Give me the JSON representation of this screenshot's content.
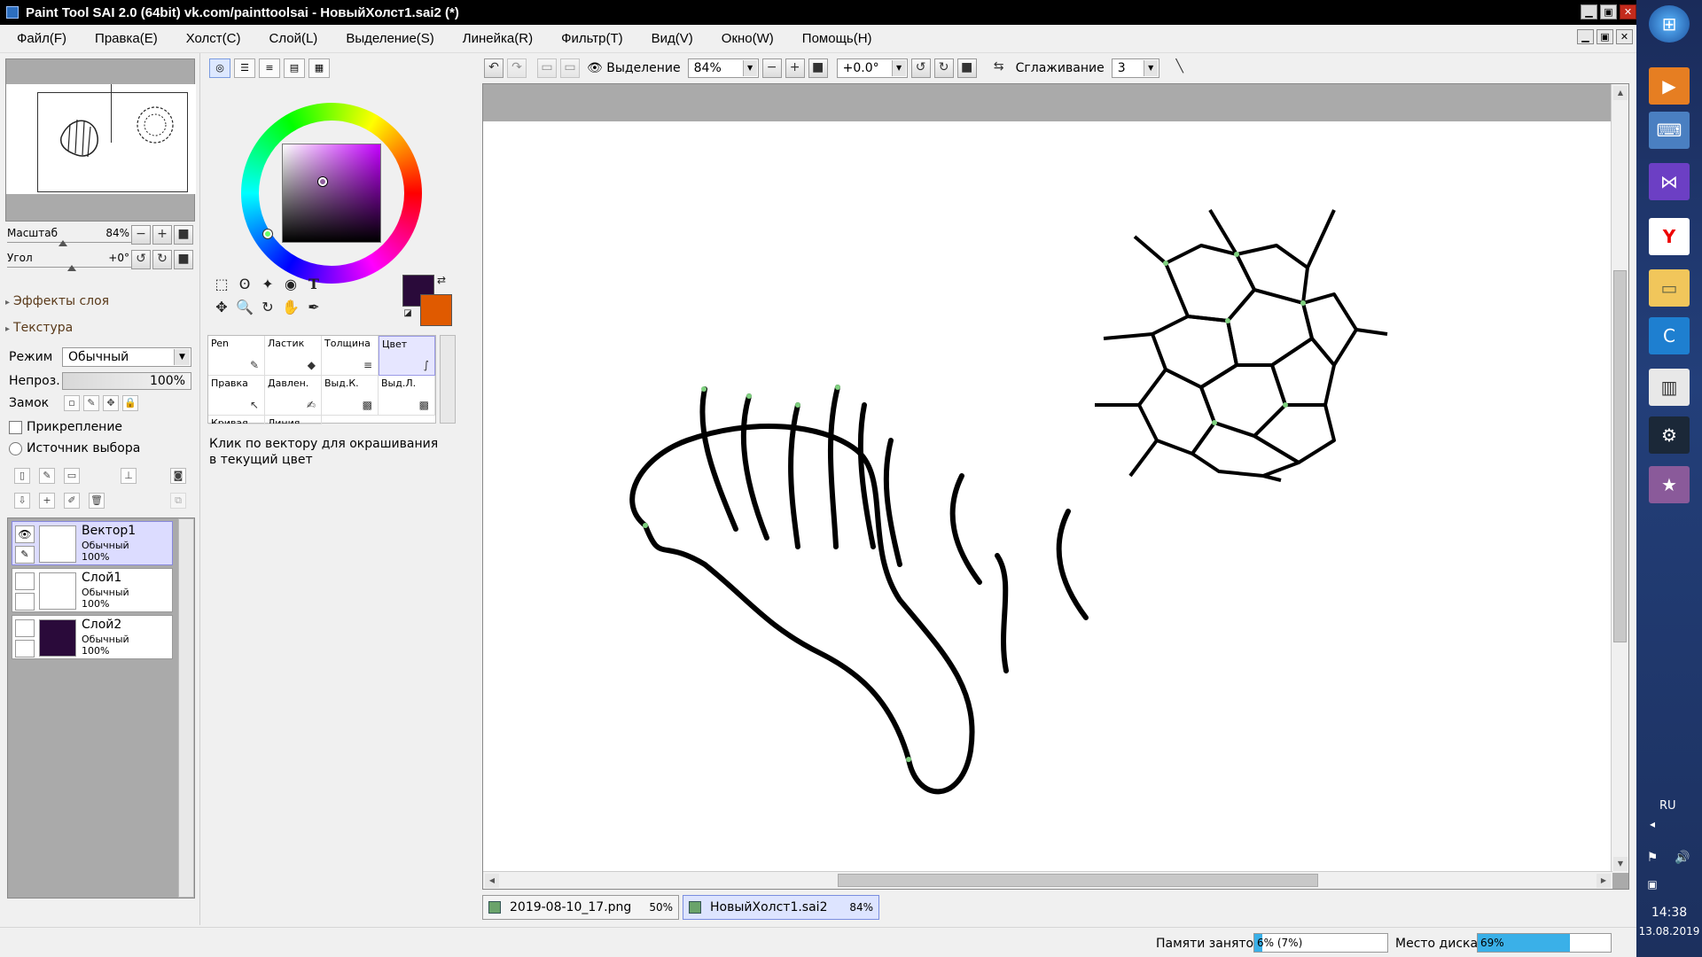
{
  "window": {
    "title": "Paint Tool SAI 2.0 (64bit) vk.com/painttoolsai - НовыйХолст1.sai2 (*)",
    "minimize": "▁",
    "restore": "▣",
    "close": "✕"
  },
  "menu": [
    "Файл(F)",
    "Правка(E)",
    "Холст(C)",
    "Слой(L)",
    "Выделение(S)",
    "Линейка(R)",
    "Фильтр(T)",
    "Вид(V)",
    "Окно(W)",
    "Помощь(H)"
  ],
  "navigator": {
    "scale_label": "Масштаб",
    "scale_value": "84%",
    "angle_label": "Угол",
    "angle_value": "+0°"
  },
  "layer_props": {
    "effects": "Эффекты слоя",
    "texture": "Текстура",
    "mode_label": "Режим",
    "mode_value": "Обычный",
    "opacity_label": "Непроз.",
    "opacity_value": "100%",
    "lock_label": "Замок",
    "clipping_label": "Прикрепление",
    "selection_source_label": "Источник выбора"
  },
  "layers": [
    {
      "name": "Вектор1",
      "mode": "Обычный",
      "opacity": "100%",
      "selected": true
    },
    {
      "name": "Слой1",
      "mode": "Обычный",
      "opacity": "100%",
      "selected": false
    },
    {
      "name": "Слой2",
      "mode": "Обычный",
      "opacity": "100%",
      "selected": false
    }
  ],
  "colors": {
    "primary": "#2a0a3a",
    "secondary": "#e05a00",
    "accent": "#3ab0e8"
  },
  "brushes": [
    {
      "label": "Pen",
      "icon": "pen-icon"
    },
    {
      "label": "Ластик",
      "icon": "eraser-icon"
    },
    {
      "label": "Толщина",
      "icon": "thickness-icon"
    },
    {
      "label": "Цвет",
      "icon": "color-icon",
      "selected": true
    },
    {
      "label": "Правка",
      "icon": "edit-icon"
    },
    {
      "label": "Давлен.",
      "icon": "pressure-icon"
    },
    {
      "label": "Выд.К.",
      "icon": "select-stroke-icon"
    },
    {
      "label": "Выд.Л.",
      "icon": "select-line-icon"
    },
    {
      "label": "Кривая",
      "icon": "curve-icon"
    },
    {
      "label": "Линия",
      "icon": "line-icon"
    }
  ],
  "tool_help": "Клик по вектору для окрашивания в текущий цвет",
  "canvas_toolbar": {
    "selection_label": "Выделение",
    "zoom_value": "84%",
    "angle_value": "+0.0°",
    "smoothing_label": "Сглаживание",
    "smoothing_value": "3"
  },
  "tabs": [
    {
      "name": "2019-08-10_17.png",
      "zoom": "50%",
      "active": false
    },
    {
      "name": "НовыйХолст1.sai2",
      "zoom": "84%",
      "active": true
    }
  ],
  "status": {
    "memory_label": "Памяти занято",
    "memory_value": "6% (7%)",
    "memory_fraction": 0.06,
    "disk_label": "Место диска",
    "disk_value": "69%",
    "disk_fraction": 0.69
  },
  "taskbar": {
    "lang": "RU",
    "time": "14:38",
    "date": "13.08.2019"
  }
}
